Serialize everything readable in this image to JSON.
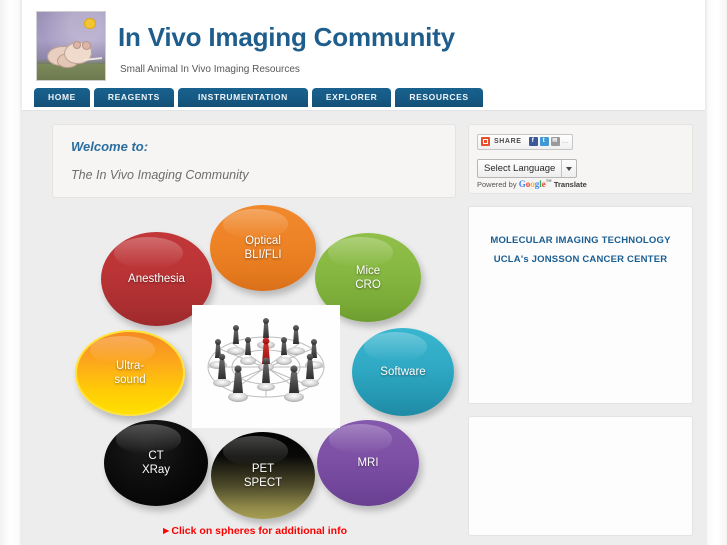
{
  "site": {
    "title": "In Vivo Imaging Community",
    "tagline": "Small Animal In Vivo Imaging Resources",
    "logo_icon": "mice-illustration-logo"
  },
  "nav": {
    "items": [
      {
        "label": "HOME"
      },
      {
        "label": "REAGENTS"
      },
      {
        "label": "INSTRUMENTATION"
      },
      {
        "label": "EXPLORER"
      },
      {
        "label": "RESOURCES"
      }
    ]
  },
  "welcome": {
    "title": "Welcome to:",
    "subtitle": "The In Vivo Imaging Community"
  },
  "spheres": {
    "hint": "►Click on spheres for additional info",
    "center_image": "people-network-graphic",
    "items": [
      {
        "name": "anesthesia",
        "label": "Anesthesia",
        "color": "#bb3436"
      },
      {
        "name": "optical",
        "label": "Optical\nBLI/FLI",
        "line1": "Optical",
        "line2": "BLI/FLI",
        "color": "#ee8326"
      },
      {
        "name": "mice-cro",
        "label": "Mice\nCRO",
        "line1": "Mice",
        "line2": "CRO",
        "color": "#86b741"
      },
      {
        "name": "ultrasound",
        "label": "Ultra-\nsound",
        "line1": "Ultra-",
        "line2": "sound",
        "color": "#ffca07"
      },
      {
        "name": "software",
        "label": "Software",
        "color": "#2fa9c4"
      },
      {
        "name": "ct-xray",
        "label": "CT\nXRay",
        "line1": "CT",
        "line2": "XRay",
        "color": "#000000"
      },
      {
        "name": "pet-spect",
        "label": "PET\nSPECT",
        "line1": "PET",
        "line2": "SPECT",
        "color": "#8e8848"
      },
      {
        "name": "mri",
        "label": "MRI",
        "color": "#7d50a5"
      }
    ]
  },
  "sidebar": {
    "share": {
      "label": "SHARE",
      "icons": [
        "share-icon",
        "facebook-icon",
        "twitter-icon",
        "email-icon",
        "more-icon"
      ],
      "facebook_glyph": "f",
      "twitter_glyph": "t",
      "mail_glyph": "✉",
      "more_glyph": "…"
    },
    "translate": {
      "selected": "Select Language",
      "powered_prefix": "Powered by",
      "brand_g": "G",
      "brand_o1": "o",
      "brand_o2": "o",
      "brand_g2": "g",
      "brand_l": "l",
      "brand_e": "e",
      "brand_tm": "™",
      "translate_word": "Translate"
    },
    "promo": {
      "line1": "MOLECULAR IMAGING TECHNOLOGY",
      "line2": "UCLA's JONSSON CANCER CENTER"
    }
  },
  "colors": {
    "brand_blue": "#1f5e8c",
    "nav_blue": "#165a85",
    "hint_red": "#fe0000",
    "page_bg": "#ededed"
  }
}
